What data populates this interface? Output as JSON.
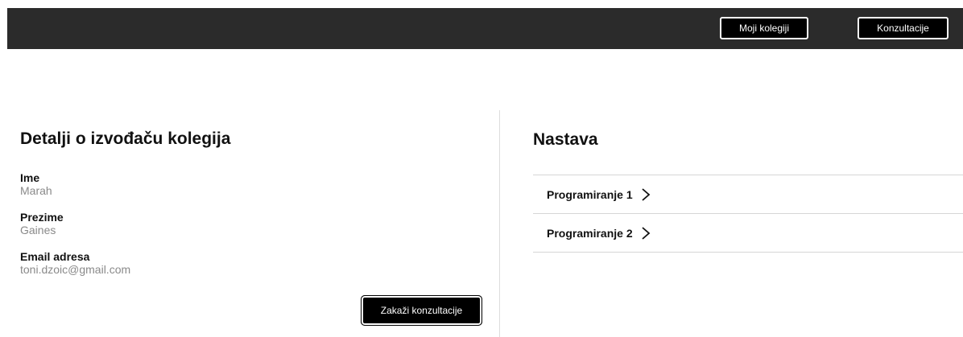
{
  "nav": {
    "moji_kolegiji": "Moji kolegiji",
    "konzultacije": "Konzultacije"
  },
  "details": {
    "heading": "Detalji o izvođaču kolegija",
    "fields": [
      {
        "label": "Ime",
        "value": "Marah"
      },
      {
        "label": "Prezime",
        "value": "Gaines"
      },
      {
        "label": "Email adresa",
        "value": "toni.dzoic@gmail.com"
      }
    ],
    "schedule_button": "Zakaži konzultacije"
  },
  "teaching": {
    "heading": "Nastava",
    "courses": [
      {
        "label": "Programiranje 1",
        "icon": "chevron-right-icon"
      },
      {
        "label": "Programiranje 2",
        "icon": "chevron-right-icon"
      }
    ]
  },
  "colors": {
    "topbar": "#2b2b2b",
    "button": "#000000",
    "muted_text": "#8a8a8a"
  }
}
